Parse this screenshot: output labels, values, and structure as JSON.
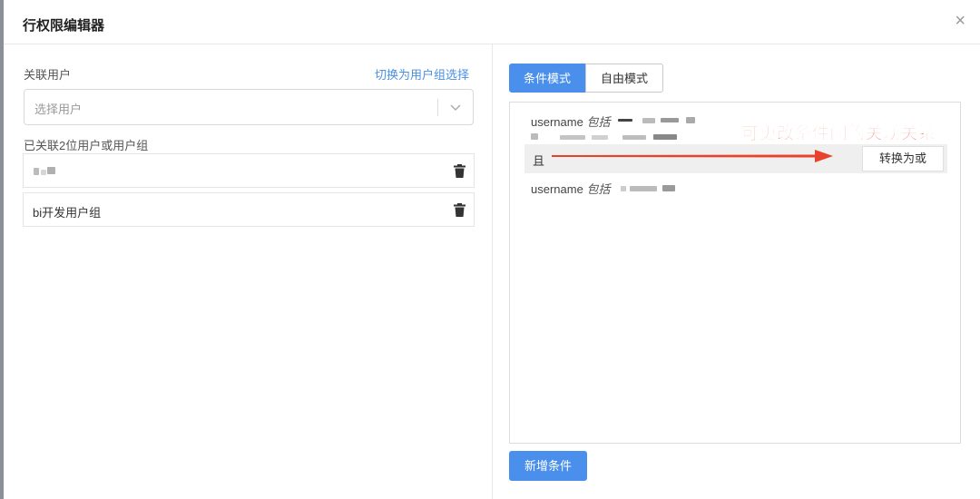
{
  "dialog": {
    "title": "行权限编辑器",
    "close_glyph": "×"
  },
  "left": {
    "associated_user_label": "关联用户",
    "switch_link": "切换为用户组选择",
    "select_placeholder": "选择用户",
    "linked_count_label": "已关联2位用户或用户组",
    "items": [
      {
        "label": ""
      },
      {
        "label": "bi开发用户组"
      }
    ]
  },
  "right": {
    "mode_tabs": [
      "条件模式",
      "自由模式"
    ],
    "conditions": [
      {
        "field": "username",
        "operator": "包括"
      },
      {
        "field": "username",
        "operator": "包括"
      }
    ],
    "logic_label": "且",
    "toggle_label": "转换为或",
    "annotation": "可更改条件间的关联关系",
    "add_condition_label": "新增条件"
  },
  "colors": {
    "primary": "#4a8fec",
    "link": "#4a90e2",
    "annotation": "#e8412c"
  },
  "icons": [
    "close-icon",
    "chevron-down-icon",
    "trash-icon",
    "arrow-icon"
  ]
}
